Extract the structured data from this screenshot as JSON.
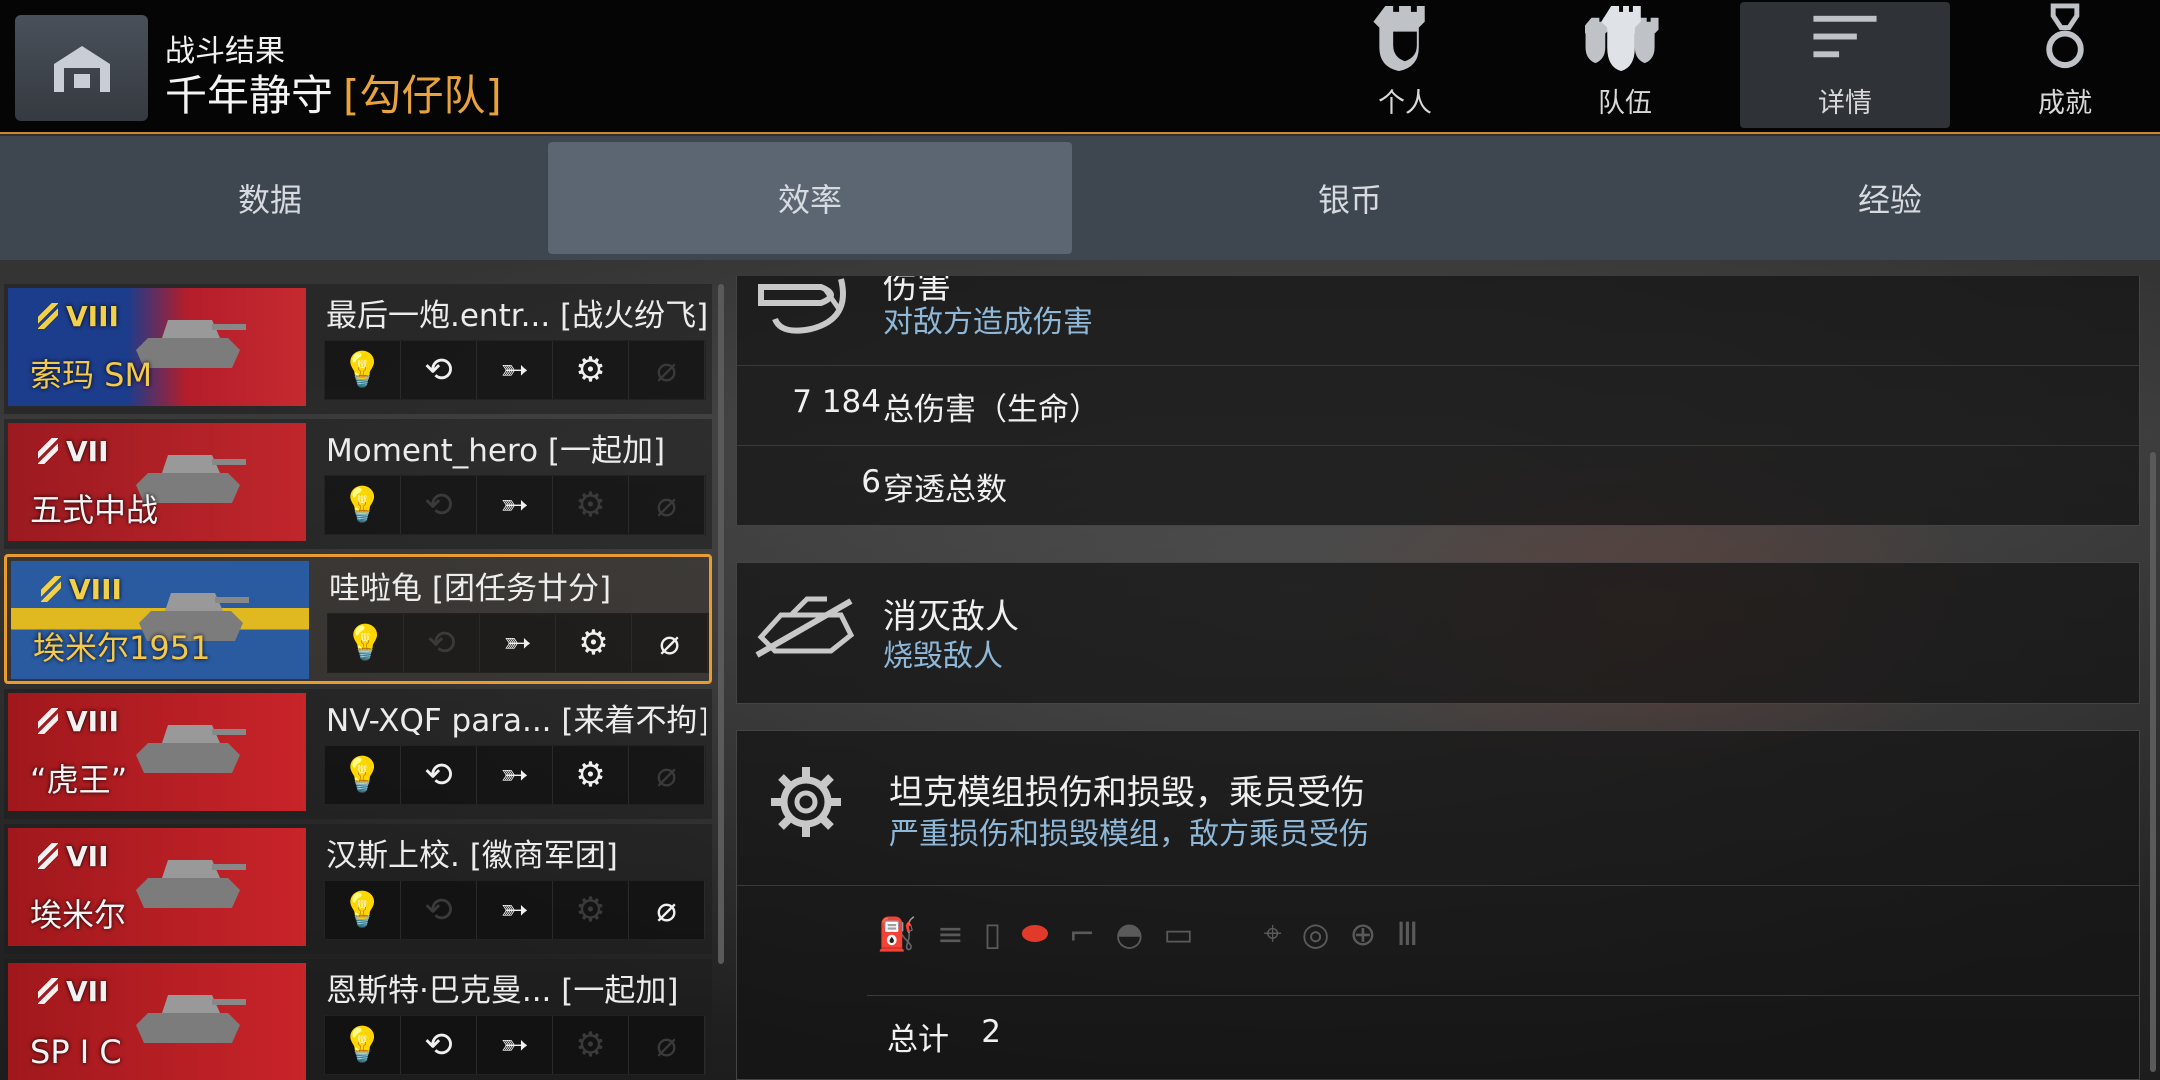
{
  "header": {
    "subtitle": "战斗结果",
    "map_name": "千年静守",
    "clan_tag": "[勾仔队]",
    "tabs": [
      {
        "label": "个人",
        "icon": "personal-icon",
        "active": false
      },
      {
        "label": "队伍",
        "icon": "team-icon",
        "active": false
      },
      {
        "label": "详情",
        "icon": "details-icon",
        "active": true
      },
      {
        "label": "成就",
        "icon": "medal-icon",
        "active": false
      }
    ]
  },
  "subtabs": [
    {
      "label": "数据",
      "active": false
    },
    {
      "label": "效率",
      "active": true
    },
    {
      "label": "银币",
      "active": false
    },
    {
      "label": "经验",
      "active": false
    }
  ],
  "players": [
    {
      "tier": "VIII",
      "tank": "索玛 SM",
      "name": "最后一炮.entr... [战火纷飞]",
      "flag": "france",
      "tier_color": "gold",
      "icons": [
        "on",
        "on",
        "on",
        "on",
        "off"
      ]
    },
    {
      "tier": "VII",
      "tank": "五式中战",
      "name": "Moment_hero [一起加]",
      "flag": "japan",
      "tier_color": "white",
      "icons": [
        "off",
        "off",
        "on",
        "off",
        "off"
      ]
    },
    {
      "tier": "VIII",
      "tank": "埃米尔1951",
      "name": "哇啦龟 [团任务廿分]",
      "flag": "sweden",
      "tier_color": "gold",
      "selected": true,
      "icons": [
        "on",
        "off",
        "on",
        "on",
        "on"
      ]
    },
    {
      "tier": "VIII",
      "tank": "“虎王”",
      "name": "NV-XQF para... [来着不拘]",
      "flag": "germany",
      "tier_color": "white",
      "icons": [
        "on",
        "on",
        "on",
        "on",
        "off"
      ]
    },
    {
      "tier": "VII",
      "tank": "埃米尔",
      "name": "汉斯上校. [徽商军团]",
      "flag": "germany",
      "tier_color": "white",
      "icons": [
        "on",
        "off",
        "on",
        "off",
        "on"
      ]
    },
    {
      "tier": "VII",
      "tank": "SP I C",
      "name": "恩斯特·巴克曼...   [一起加]",
      "flag": "germany",
      "tier_color": "white",
      "icons": [
        "off",
        "on",
        "on",
        "off",
        "off"
      ]
    }
  ],
  "damage": {
    "title": "伤害",
    "desc": "对敌方造成伤害",
    "rows": [
      {
        "value": "7 184",
        "label": "总伤害（生命）"
      },
      {
        "value": "6",
        "label": "穿透总数"
      }
    ]
  },
  "kills": {
    "title": "消灭敌人",
    "desc": "烧毁敌人"
  },
  "modules": {
    "title": "坦克模组损伤和损毁，乘员受伤",
    "desc": "严重损伤和损毁模组，敌方乘员受伤",
    "total_value": "2",
    "total_label": "总计",
    "module_icons": [
      "engine-icon",
      "ammo-icon",
      "fuel-icon",
      "track-icon",
      "gun-icon",
      "turret-icon",
      "radio-icon",
      "commander-icon",
      "driver-icon",
      "gunner-icon",
      "loader-icon"
    ]
  },
  "colors": {
    "accent": "#e89b2f",
    "gold_text": "#f2c94c",
    "desc_blue": "#8fb8d8",
    "damaged_module": "#e23a2a"
  }
}
